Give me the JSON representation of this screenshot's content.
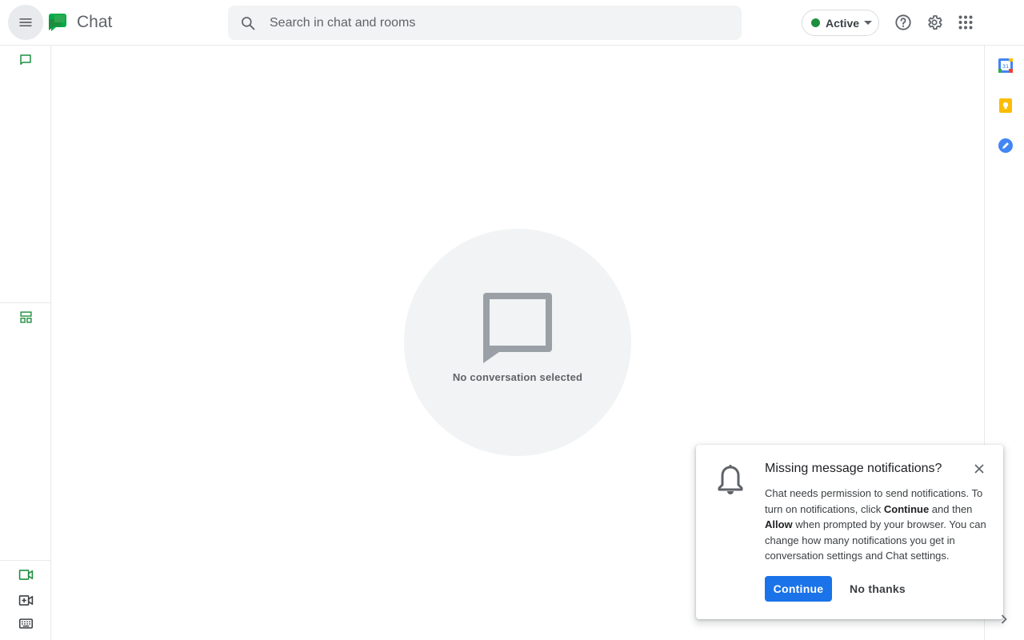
{
  "header": {
    "app_title": "Chat",
    "search_placeholder": "Search in chat and rooms",
    "search_value": "",
    "status": {
      "label": "Active",
      "color": "#1e8e3e"
    },
    "icons": [
      "menu-icon",
      "chat-logo-icon",
      "search-icon",
      "help-icon",
      "gear-icon",
      "apps-grid-icon"
    ]
  },
  "left_rail": {
    "items": [
      {
        "name": "chat-icon"
      },
      {
        "name": "rooms-icon"
      },
      {
        "name": "meet-icon"
      },
      {
        "name": "new-meeting-icon"
      },
      {
        "name": "keyboard-icon"
      }
    ],
    "accent": "#1e8e3e"
  },
  "side_panel": {
    "apps": [
      "calendar-icon",
      "keep-icon",
      "tasks-icon"
    ]
  },
  "main": {
    "empty_state_text": "No conversation selected"
  },
  "notification": {
    "title": "Missing message notifications?",
    "body_part1": "Chat needs permission to send notifications. To turn on notifications, click ",
    "body_bold1": "Continue",
    "body_part2": " and then ",
    "body_bold2": "Allow",
    "body_part3": " when prompted by your browser. You can change how many notifications you get in conversation settings and Chat settings.",
    "continue_label": "Continue",
    "no_thanks_label": "No thanks",
    "accent": "#1a73e8"
  }
}
